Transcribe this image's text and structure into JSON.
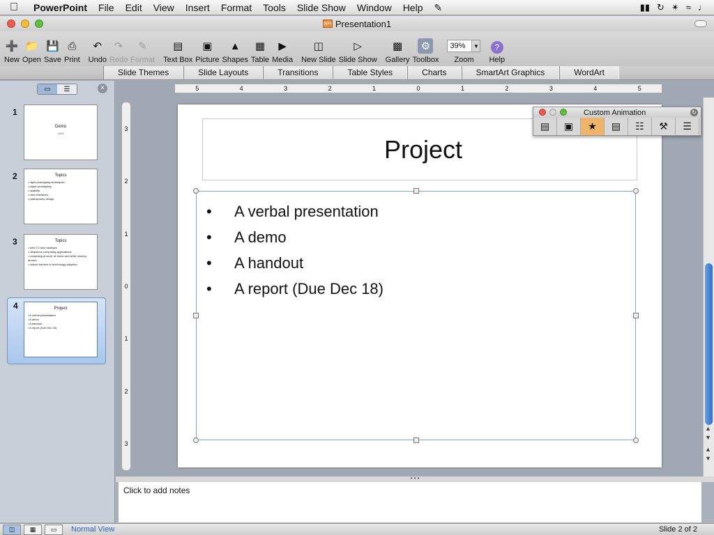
{
  "menubar": {
    "app": "PowerPoint",
    "items": [
      "File",
      "Edit",
      "View",
      "Insert",
      "Format",
      "Tools",
      "Slide Show",
      "Window",
      "Help"
    ]
  },
  "window": {
    "title": "Presentation1",
    "doc_badge": "pptx"
  },
  "toolbar": {
    "new": "New",
    "open": "Open",
    "save": "Save",
    "print": "Print",
    "undo": "Undo",
    "redo": "Redo",
    "format": "Format",
    "textbox": "Text Box",
    "picture": "Picture",
    "shapes": "Shapes",
    "table": "Table",
    "media": "Media",
    "newslide": "New Slide",
    "slideshow": "Slide Show",
    "gallery": "Gallery",
    "toolbox": "Toolbox",
    "zoom_value": "39%",
    "zoom": "Zoom",
    "help": "Help"
  },
  "ribbon_tabs": [
    "Slide Themes",
    "Slide Layouts",
    "Transitions",
    "Table Styles",
    "Charts",
    "SmartArt Graphics",
    "WordArt"
  ],
  "slides": [
    {
      "num": "1",
      "title": "Demo",
      "subtitle": "2008"
    },
    {
      "num": "2",
      "title": "Topics",
      "bullets": [
        "rapid prototyping techniques",
        "paper prototyping",
        "usability",
        "user interfaces",
        "participatory design"
      ]
    },
    {
      "num": "3",
      "title": "Topics",
      "bullets": [
        "web 2.0 and mashups",
        "ubiquitous computing applications",
        "computing at work, at home and while moving around",
        "reduce barriers to technology adoption"
      ]
    },
    {
      "num": "4",
      "title": "Project",
      "bullets": [
        "A verbal presentation",
        "A demo",
        "A handout",
        "A report (Due Dec 18)"
      ]
    }
  ],
  "ruler": {
    "h_ticks": [
      "5",
      "4",
      "3",
      "2",
      "1",
      "0",
      "1",
      "2",
      "3",
      "4",
      "5"
    ],
    "v_ticks": [
      "3",
      "2",
      "1",
      "0",
      "1",
      "2",
      "3"
    ]
  },
  "current_slide": {
    "title": "Project",
    "bullets": [
      "A verbal presentation",
      "A demo",
      "A handout",
      "A report (Due Dec 18)"
    ]
  },
  "custom_animation": {
    "title": "Custom Animation"
  },
  "notes": {
    "placeholder": "Click to add notes"
  },
  "status": {
    "view": "Normal View",
    "slide_pos": "Slide 2 of 2"
  },
  "colors": {
    "selection_blue": "#7aa7d6",
    "scroll_knob": "#2f6fc9",
    "animation_active": "#f0b36a"
  }
}
